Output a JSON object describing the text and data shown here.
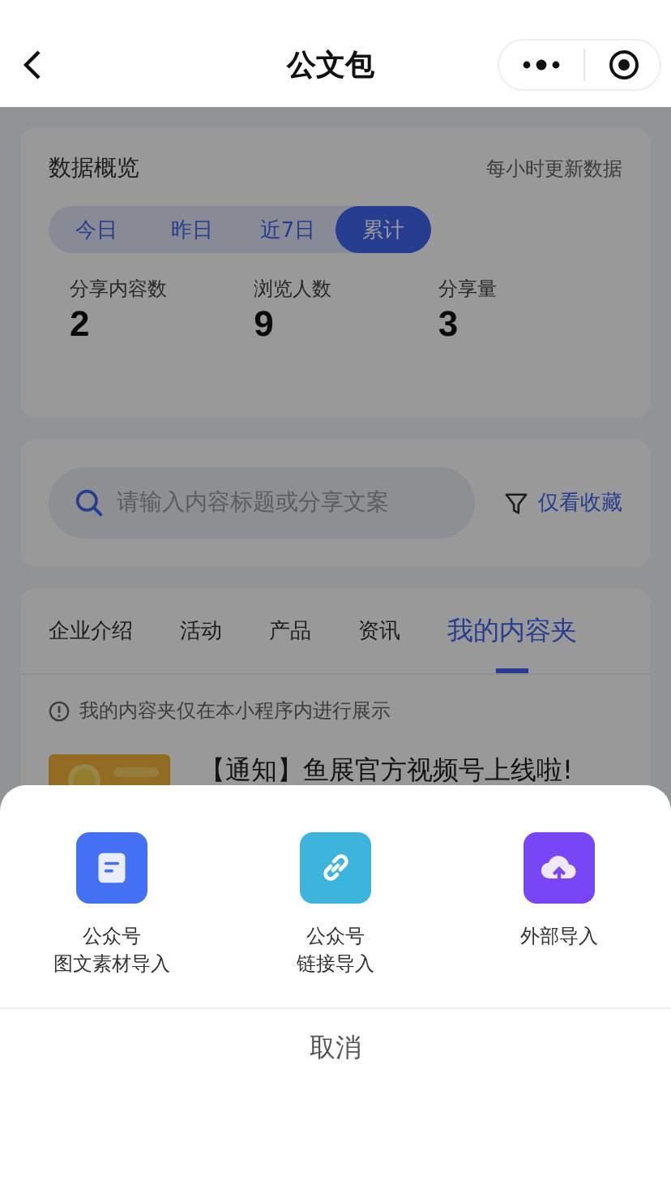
{
  "nav": {
    "title": "公文包"
  },
  "overview": {
    "title": "数据概览",
    "note": "每小时更新数据",
    "periods": [
      {
        "label": "今日",
        "selected": false
      },
      {
        "label": "昨日",
        "selected": false
      },
      {
        "label": "近7日",
        "selected": false
      },
      {
        "label": "累计",
        "selected": true
      }
    ],
    "stats": [
      {
        "label": "分享内容数",
        "value": "2"
      },
      {
        "label": "浏览人数",
        "value": "9"
      },
      {
        "label": "分享量",
        "value": "3"
      }
    ]
  },
  "search": {
    "placeholder": "请输入内容标题或分享文案",
    "filter": "仅看收藏"
  },
  "categories": [
    {
      "label": "企业介绍",
      "selected": false
    },
    {
      "label": "活动",
      "selected": false
    },
    {
      "label": "产品",
      "selected": false
    },
    {
      "label": "资讯",
      "selected": false
    },
    {
      "label": "我的内容夹",
      "selected": true
    }
  ],
  "notice": "我的内容夹仅在本小程序内进行展示",
  "articles": [
    {
      "title": "【通知】鱼展官方视频号上线啦!"
    }
  ],
  "sheet": {
    "options": [
      {
        "kind": "document",
        "color": "#4470f4",
        "lines": [
          "公众号",
          "图文素材导入"
        ]
      },
      {
        "kind": "link",
        "color": "#3db4dc",
        "lines": [
          "公众号",
          "链接导入"
        ]
      },
      {
        "kind": "cloud",
        "color": "#7846f5",
        "lines": [
          "外部导入"
        ]
      }
    ],
    "cancel": "取消"
  }
}
